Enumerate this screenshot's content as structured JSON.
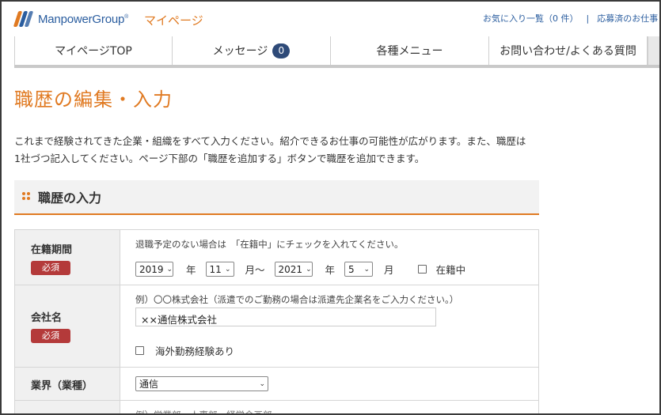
{
  "header": {
    "logo_text": "ManpowerGroup",
    "logo_tm": "®",
    "mypage_title": "マイページ",
    "favorites_link": "お気に入り一覧（0 件）",
    "separator": "|",
    "applied_link": "応募済のお仕事",
    "brand_colors": {
      "logo_blue": "#2a5d9f",
      "accent_orange": "#e07a22"
    }
  },
  "nav": {
    "items": [
      {
        "label": "マイページTOP"
      },
      {
        "label": "メッセージ",
        "badge": "0"
      },
      {
        "label": "各種メニュー"
      },
      {
        "label": "お問い合わせ/よくある質問"
      }
    ]
  },
  "page": {
    "title": "職歴の編集・入力",
    "intro_line1": "これまで経験されてきた企業・組織をすべて入力ください。紹介できるお仕事の可能性が広がります。また、職歴は",
    "intro_line2": "1社づつ記入してください。ページ下部の「職歴を追加する」ボタンで職歴を追加できます。"
  },
  "section": {
    "title": "職歴の入力",
    "icon": "four-dots-icon"
  },
  "form": {
    "required_label": "必須",
    "period": {
      "label": "在籍期間",
      "note": "退職予定のない場合は　「在籍中」にチェックを入れてください。",
      "start_year": "2019",
      "start_month": "11",
      "end_year": "2021",
      "end_month": "5",
      "unit_year": "年",
      "unit_month_range": "月〜",
      "unit_month": "月",
      "current_label": "在籍中",
      "current_checked": false
    },
    "company": {
      "label": "会社名",
      "note": "例）〇〇株式会社（派遣でのご勤務の場合は派遣先企業名をご入力ください。）",
      "value": "××通信株式会社",
      "overseas_label": "海外勤務経験あり",
      "overseas_checked": false
    },
    "industry": {
      "label": "業界（業種）",
      "value": "通信"
    },
    "partial_note": "例）営業部　人事部　経営企画部"
  }
}
